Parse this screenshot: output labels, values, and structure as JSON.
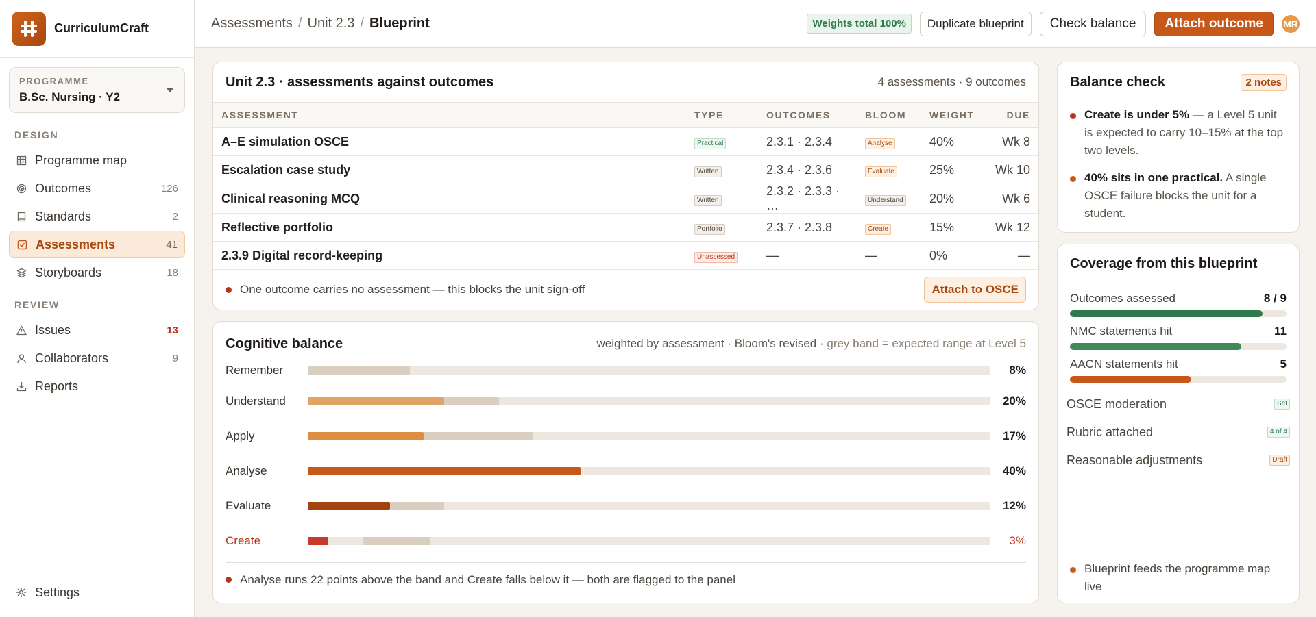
{
  "brand": {
    "name": "CurriculumCraft",
    "logo_icon": "hash-icon"
  },
  "programme": {
    "label": "PROGRAMME",
    "value": "B.Sc. Nursing · Y2"
  },
  "nav": {
    "design_label": "DESIGN",
    "review_label": "REVIEW",
    "design": [
      {
        "label": "Programme map",
        "count": "",
        "icon": "grid-icon"
      },
      {
        "label": "Outcomes",
        "count": "126",
        "icon": "target-icon"
      },
      {
        "label": "Standards",
        "count": "2",
        "icon": "book-icon"
      },
      {
        "label": "Assessments",
        "count": "41",
        "icon": "checkbox-icon",
        "active": true
      },
      {
        "label": "Storyboards",
        "count": "18",
        "icon": "layers-icon"
      }
    ],
    "review": [
      {
        "label": "Issues",
        "count": "13",
        "icon": "warning-icon",
        "alert": true
      },
      {
        "label": "Collaborators",
        "count": "9",
        "icon": "user-icon"
      },
      {
        "label": "Reports",
        "count": "",
        "icon": "download-icon"
      }
    ],
    "settings": "Settings"
  },
  "topbar": {
    "crumbs": [
      "Assessments",
      "Unit 2.3",
      "Blueprint"
    ],
    "sep": "/",
    "weights_pill": "Weights total 100%",
    "duplicate": "Duplicate blueprint",
    "check_balance": "Check balance",
    "attach_outcome": "Attach outcome",
    "avatar": "MR"
  },
  "assess_card": {
    "title": "Unit 2.3 · assessments against outcomes",
    "meta": "4 assessments · 9 outcomes",
    "columns": [
      "ASSESSMENT",
      "TYPE",
      "OUTCOMES",
      "BLOOM",
      "WEIGHT",
      "DUE"
    ],
    "rows": [
      {
        "name": "A–E simulation OSCE",
        "type": "Practical",
        "outcomes": "2.3.1 · 2.3.4",
        "bloom": "Analyse",
        "weight": "40%",
        "due": "Wk 8"
      },
      {
        "name": "Escalation case study",
        "type": "Written",
        "outcomes": "2.3.4 · 2.3.6",
        "bloom": "Evaluate",
        "weight": "25%",
        "due": "Wk 10"
      },
      {
        "name": "Clinical reasoning MCQ",
        "type": "Written",
        "outcomes": "2.3.2 · 2.3.3 · …",
        "bloom": "Understand",
        "weight": "20%",
        "due": "Wk 6"
      },
      {
        "name": "Reflective portfolio",
        "type": "Portfolio",
        "outcomes": "2.3.7 · 2.3.8",
        "bloom": "Create",
        "weight": "15%",
        "due": "Wk 12"
      },
      {
        "name": "2.3.9 Digital record-keeping",
        "type": "Unassessed",
        "outcomes": "—",
        "bloom": "—",
        "weight": "0%",
        "due": "—"
      }
    ],
    "warning": "One outcome carries no assessment — this blocks the unit sign-off",
    "attach_btn": "Attach to OSCE"
  },
  "cognitive": {
    "title": "Cognitive balance",
    "meta_main": "weighted by assessment · Bloom's revised · ",
    "meta_muted": "grey band = expected range at Level 5",
    "levels": [
      {
        "label": "Remember",
        "value": 8,
        "display": "8%",
        "band": [
          8,
          15
        ],
        "color": "#d9cebf"
      },
      {
        "label": "Understand",
        "value": 20,
        "display": "20%",
        "band": [
          20,
          28
        ],
        "color": "#e0a466"
      },
      {
        "label": "Apply",
        "value": 17,
        "display": "17%",
        "band": [
          17,
          33
        ],
        "color": "#dd8e42"
      },
      {
        "label": "Analyse",
        "value": 40,
        "display": "40%",
        "band": [
          12,
          18
        ],
        "color": "#c8581a"
      },
      {
        "label": "Evaluate",
        "value": 12,
        "display": "12%",
        "band": [
          12,
          20
        ],
        "color": "#a2440f"
      },
      {
        "label": "Create",
        "value": 3,
        "display": "3%",
        "band": [
          8,
          18
        ],
        "color": "#c83a2a",
        "alert": true
      }
    ],
    "footer": "Analyse runs 22 points above the band and Create falls below it — both are flagged to the panel"
  },
  "balance": {
    "title": "Balance check",
    "badge": "2 notes",
    "notes": [
      {
        "bold": "Create is under 5%",
        "text": " — a Level 5 unit is expected to carry 10–15% at the top two levels."
      },
      {
        "bold": "40% sits in one practical.",
        "text": " A single OSCE failure blocks the unit for a student."
      }
    ]
  },
  "coverage": {
    "title": "Coverage from this blueprint",
    "metrics": [
      {
        "label": "Outcomes assessed",
        "value": "8 / 9",
        "fraction": 0.89,
        "color": "#2f7a4a"
      },
      {
        "label": "NMC statements hit",
        "value": "11",
        "fraction": 0.79,
        "color": "#3f8a5a"
      },
      {
        "label": "AACN statements hit",
        "value": "5",
        "fraction": 0.56,
        "color": "#c8581a"
      }
    ],
    "statuses": [
      {
        "label": "OSCE moderation",
        "tag": "Set",
        "kind": "set"
      },
      {
        "label": "Rubric attached",
        "tag": "4 of 4",
        "kind": "set"
      },
      {
        "label": "Reasonable adjustments",
        "tag": "Draft",
        "kind": "draft"
      }
    ],
    "footer": "Blueprint feeds the programme map live"
  }
}
